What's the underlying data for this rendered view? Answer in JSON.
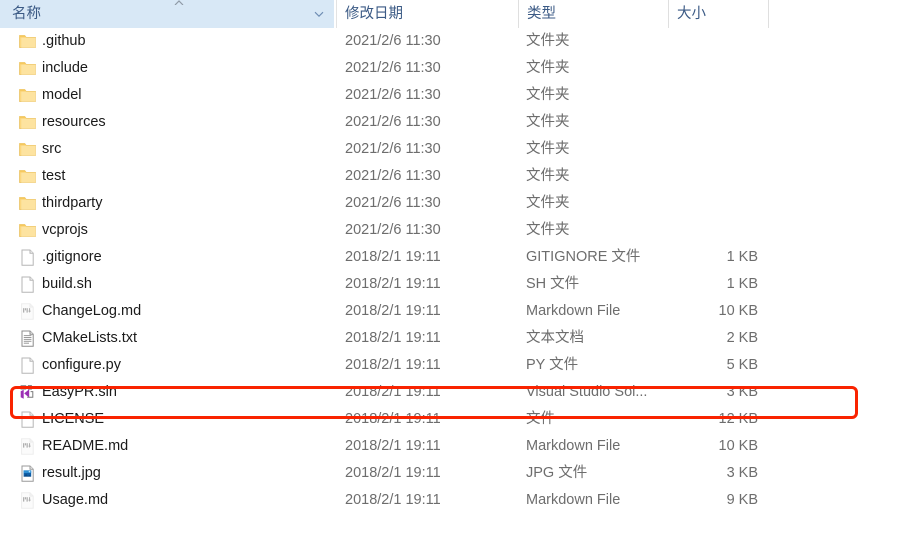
{
  "columns": {
    "name": "名称",
    "date_modified": "修改日期",
    "type": "类型",
    "size": "大小",
    "sort_indicator": "chevron-down-icon"
  },
  "annotation": {
    "color": "#f92300",
    "target_row": "EasyPR.sln"
  },
  "rows": [
    {
      "name": ".github",
      "date": "2021/2/6 11:30",
      "type": "文件夹",
      "size": "",
      "icon": "folder-icon"
    },
    {
      "name": "include",
      "date": "2021/2/6 11:30",
      "type": "文件夹",
      "size": "",
      "icon": "folder-icon"
    },
    {
      "name": "model",
      "date": "2021/2/6 11:30",
      "type": "文件夹",
      "size": "",
      "icon": "folder-icon"
    },
    {
      "name": "resources",
      "date": "2021/2/6 11:30",
      "type": "文件夹",
      "size": "",
      "icon": "folder-icon"
    },
    {
      "name": "src",
      "date": "2021/2/6 11:30",
      "type": "文件夹",
      "size": "",
      "icon": "folder-icon"
    },
    {
      "name": "test",
      "date": "2021/2/6 11:30",
      "type": "文件夹",
      "size": "",
      "icon": "folder-icon"
    },
    {
      "name": "thirdparty",
      "date": "2021/2/6 11:30",
      "type": "文件夹",
      "size": "",
      "icon": "folder-icon"
    },
    {
      "name": "vcprojs",
      "date": "2021/2/6 11:30",
      "type": "文件夹",
      "size": "",
      "icon": "folder-icon"
    },
    {
      "name": ".gitignore",
      "date": "2018/2/1 19:11",
      "type": "GITIGNORE 文件",
      "size": "1 KB",
      "icon": "blank-file-icon"
    },
    {
      "name": "build.sh",
      "date": "2018/2/1 19:11",
      "type": "SH 文件",
      "size": "1 KB",
      "icon": "blank-file-icon"
    },
    {
      "name": "ChangeLog.md",
      "date": "2018/2/1 19:11",
      "type": "Markdown File",
      "size": "10 KB",
      "icon": "markdown-file-icon"
    },
    {
      "name": "CMakeLists.txt",
      "date": "2018/2/1 19:11",
      "type": "文本文档",
      "size": "2 KB",
      "icon": "text-file-icon"
    },
    {
      "name": "configure.py",
      "date": "2018/2/1 19:11",
      "type": "PY 文件",
      "size": "5 KB",
      "icon": "blank-file-icon"
    },
    {
      "name": "EasyPR.sln",
      "date": "2018/2/1 19:11",
      "type": "Visual Studio Sol...",
      "size": "3 KB",
      "icon": "visual-studio-solution-icon"
    },
    {
      "name": "LICENSE",
      "date": "2018/2/1 19:11",
      "type": "文件",
      "size": "12 KB",
      "icon": "blank-file-icon"
    },
    {
      "name": "README.md",
      "date": "2018/2/1 19:11",
      "type": "Markdown File",
      "size": "10 KB",
      "icon": "markdown-file-icon"
    },
    {
      "name": "result.jpg",
      "date": "2018/2/1 19:11",
      "type": "JPG 文件",
      "size": "3 KB",
      "icon": "jpg-image-icon"
    },
    {
      "name": "Usage.md",
      "date": "2018/2/1 19:11",
      "type": "Markdown File",
      "size": "9 KB",
      "icon": "markdown-file-icon"
    }
  ]
}
